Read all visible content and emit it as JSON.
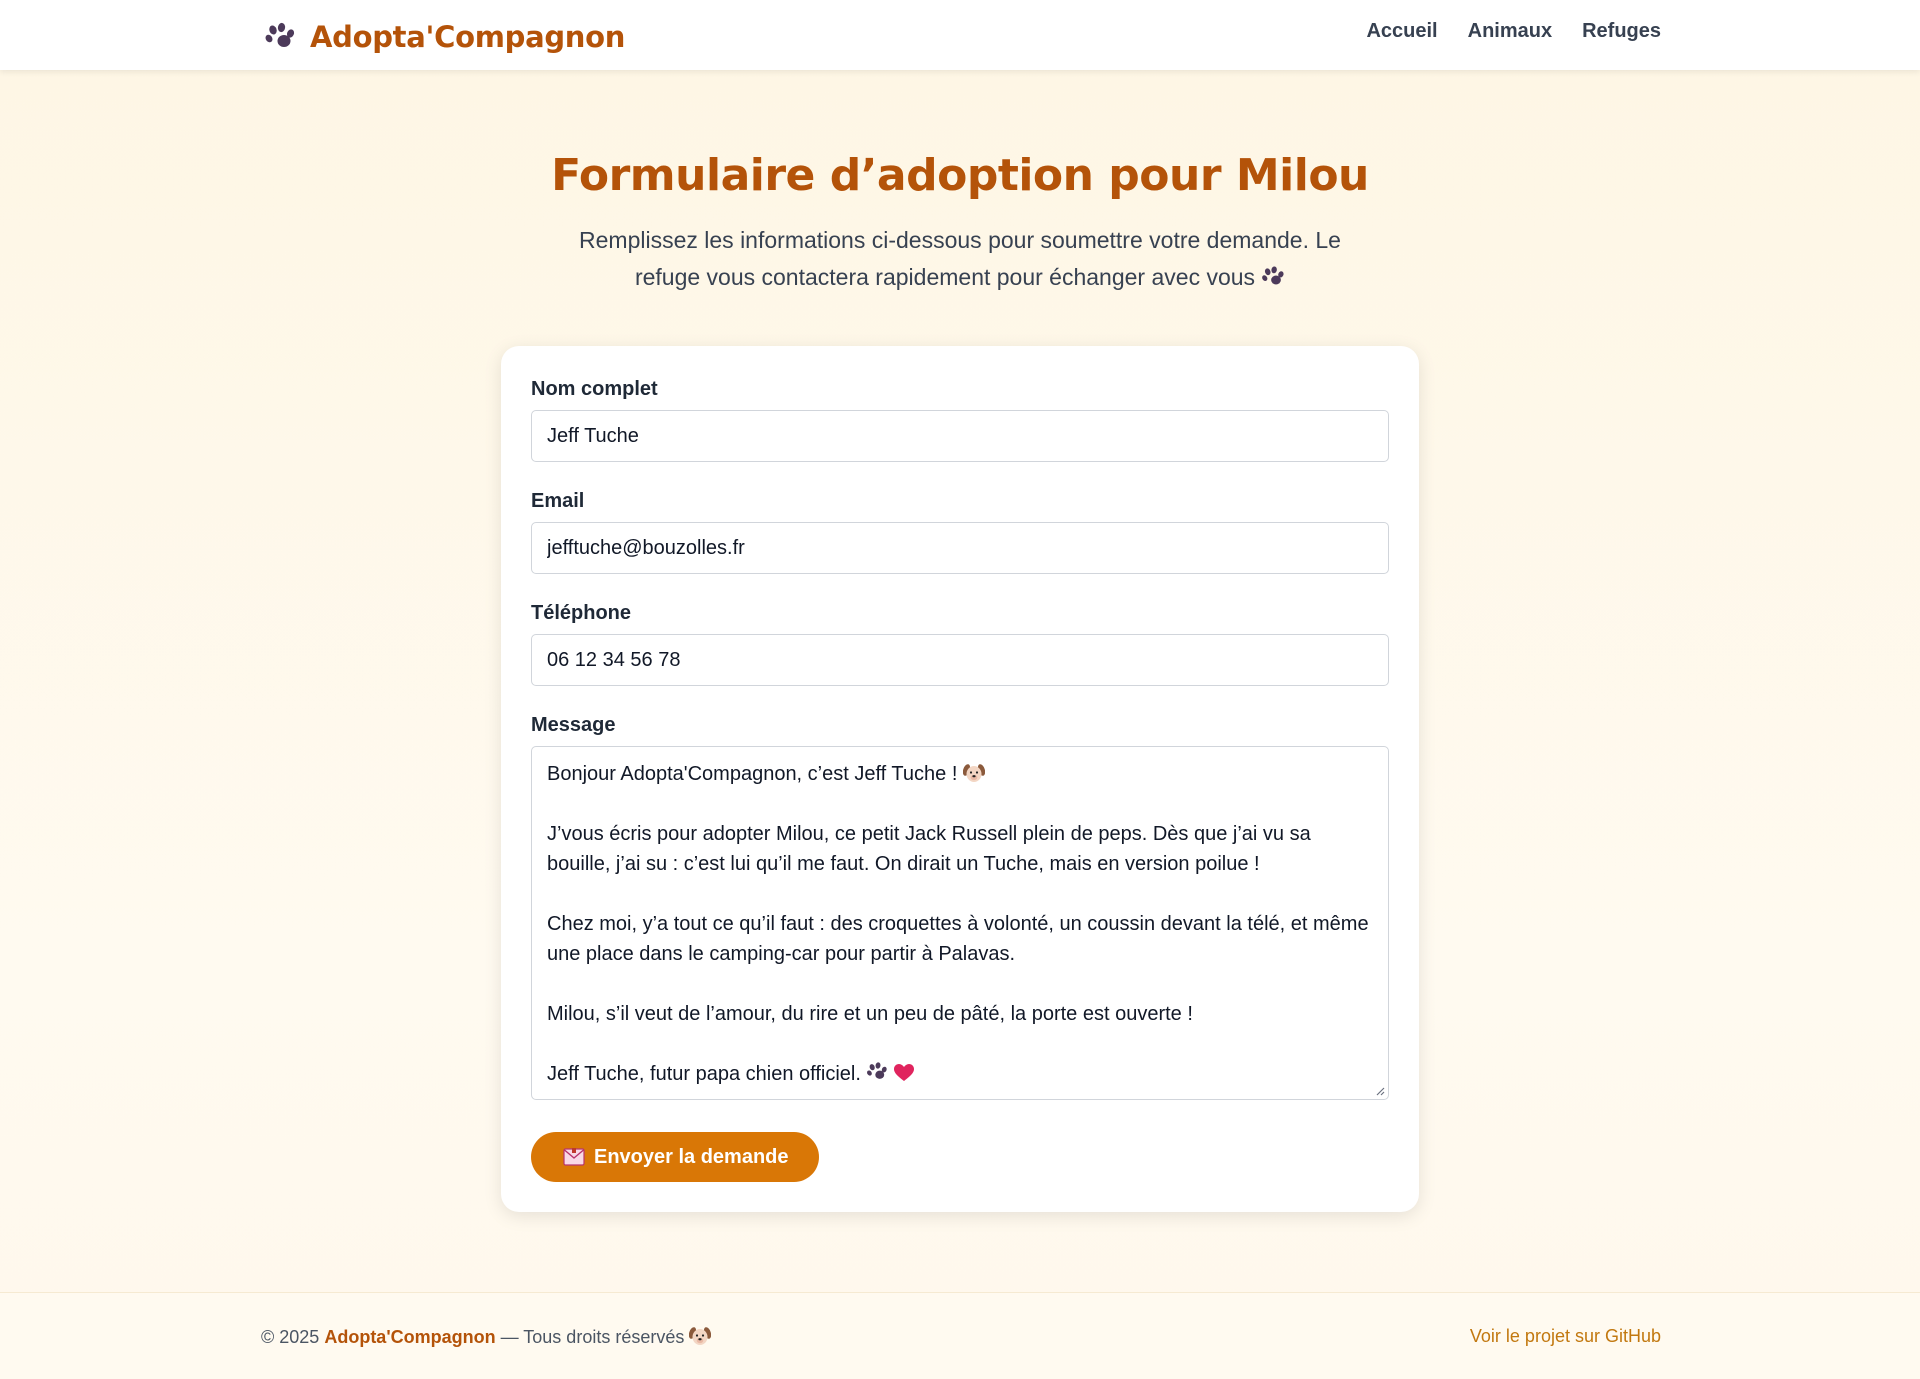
{
  "header": {
    "brand": "Adopta'Compagnon",
    "nav": [
      {
        "label": "Accueil"
      },
      {
        "label": "Animaux"
      },
      {
        "label": "Refuges"
      }
    ]
  },
  "page": {
    "title": "Formulaire d’adoption pour Milou",
    "subtitle": "Remplissez les informations ci-dessous pour soumettre votre demande. Le refuge vous contactera rapidement pour échanger avec vous"
  },
  "form": {
    "name": {
      "label": "Nom complet",
      "value": "Jeff Tuche"
    },
    "email": {
      "label": "Email",
      "value": "jefftuche@bouzolles.fr"
    },
    "phone": {
      "label": "Téléphone",
      "value": "06 12 34 56 78"
    },
    "message": {
      "label": "Message",
      "line1": "Bonjour Adopta'Compagnon, c’est Jeff Tuche !",
      "para2": "J’vous écris pour adopter Milou, ce petit Jack Russell plein de peps. Dès que j’ai vu sa bouille, j’ai su : c’est lui qu’il me faut. On dirait un Tuche, mais en version poilue !",
      "para3": "Chez moi, y’a tout ce qu’il faut : des croquettes à volonté, un coussin devant la télé, et même une place dans le camping-car pour partir à Palavas.",
      "para4": "Milou, s’il veut de l’amour, du rire et un peu de pâté, la porte est ouverte !",
      "signature": "Jeff Tuche, futur papa chien officiel."
    },
    "submit_label": "Envoyer la demande"
  },
  "footer": {
    "copyright": "© 2025",
    "brand": "Adopta'Compagnon",
    "rights": "— Tous droits réservés",
    "github_link": "Voir le projet sur GitHub"
  },
  "icons": {
    "brand": "paw-icon",
    "subtitle": "paw-icon",
    "message_line1": "dog-face-icon",
    "signature": [
      "paw-icon",
      "heart-icon"
    ],
    "submit": "envelope-icon",
    "footer": "dog-face-icon"
  },
  "colors": {
    "brand": "#b45309",
    "button": "#d97706",
    "link": "#c2780f"
  }
}
